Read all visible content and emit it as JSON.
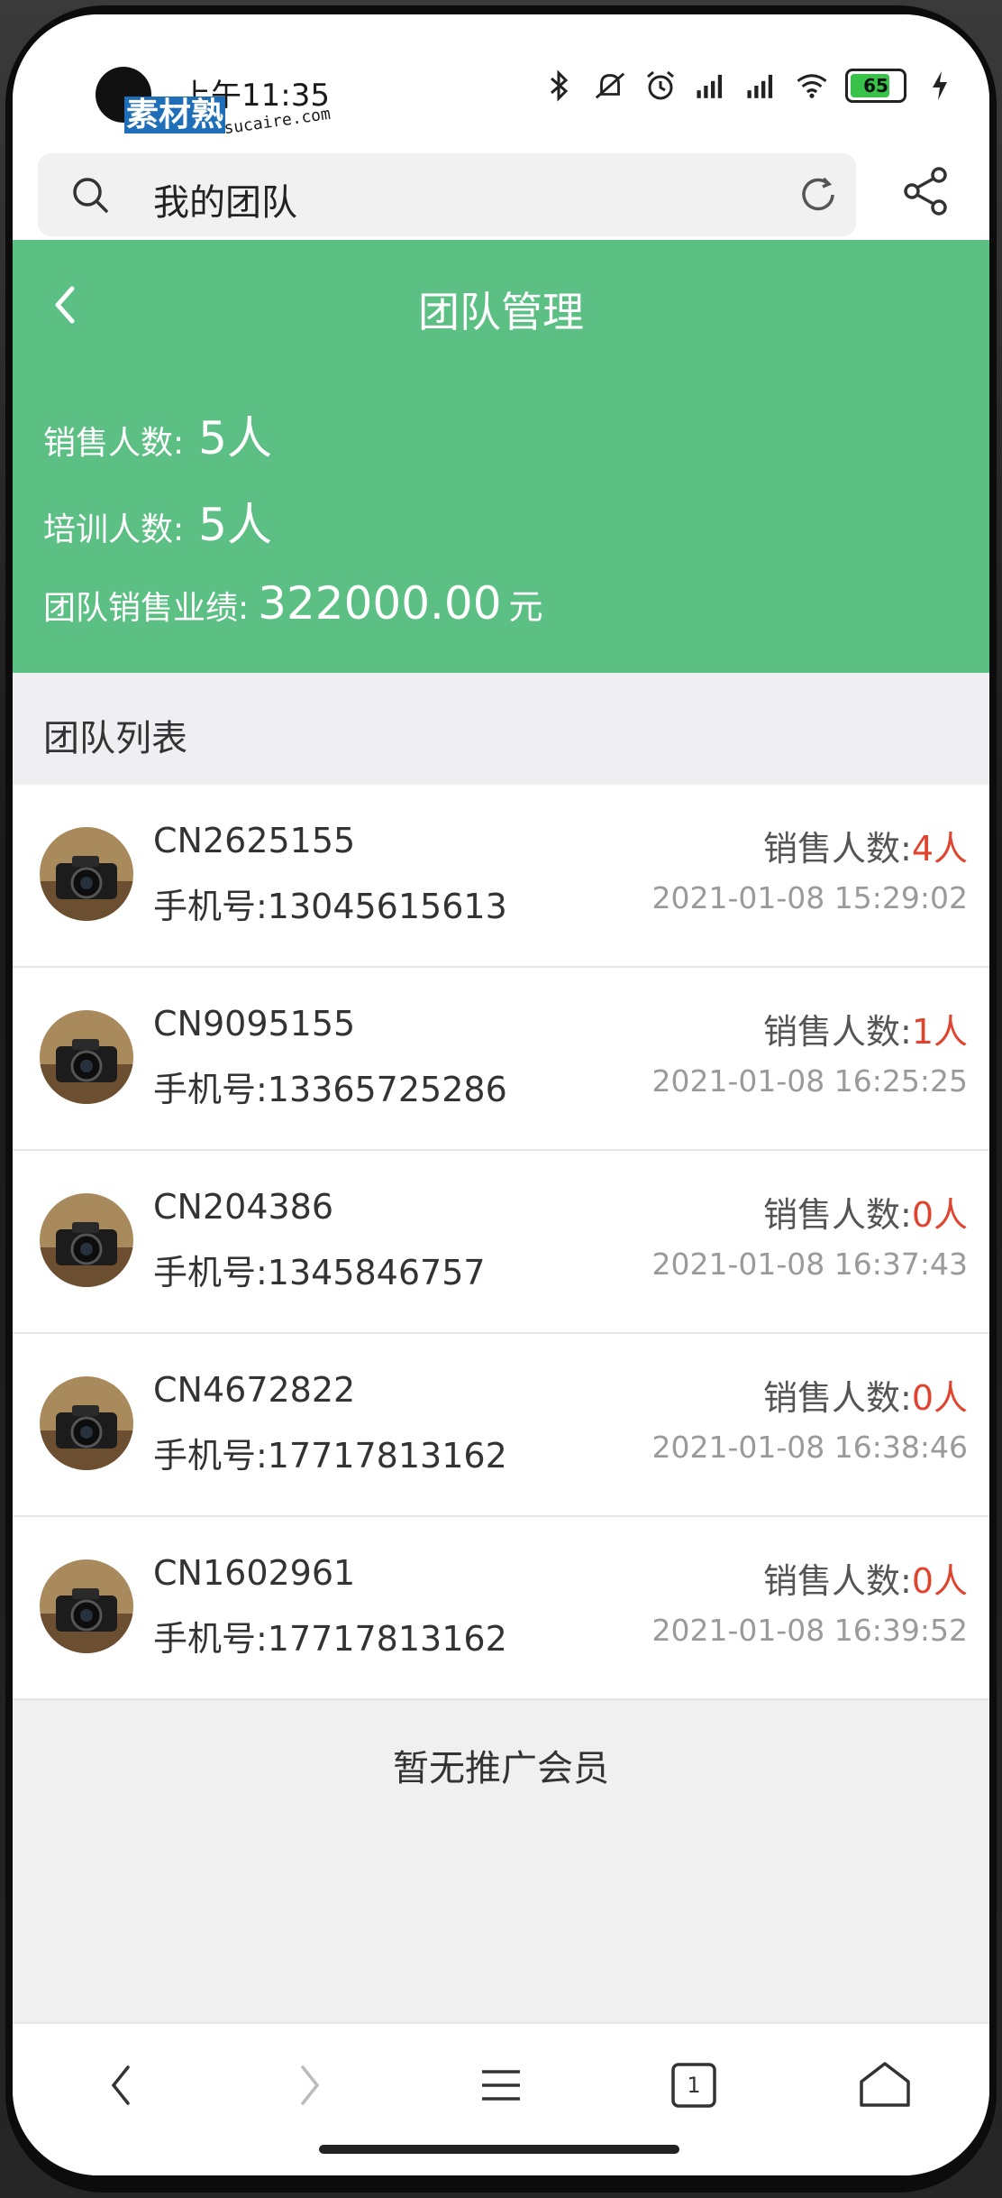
{
  "status_bar": {
    "time": "上午11:35",
    "watermark_main": "素材熟",
    "watermark_sub": "sucaire.com",
    "battery": "65"
  },
  "search": {
    "text": "我的团队"
  },
  "header": {
    "title": "团队管理",
    "sales_label": "销售人数:",
    "sales_value": "5人",
    "training_label": "培训人数:",
    "training_value": "5人",
    "performance_label": "团队销售业绩:",
    "performance_value": "322000.00",
    "performance_unit": "元"
  },
  "list": {
    "heading": "团队列表",
    "sales_label": "销售人数:",
    "items": [
      {
        "id": "CN2625155",
        "phone": "手机号:13045615613",
        "sales": "4人",
        "date": "2021-01-08 15:29:02"
      },
      {
        "id": "CN9095155",
        "phone": "手机号:13365725286",
        "sales": "1人",
        "date": "2021-01-08 16:25:25"
      },
      {
        "id": "CN204386",
        "phone": "手机号:1345846757",
        "sales": "0人",
        "date": "2021-01-08 16:37:43"
      },
      {
        "id": "CN4672822",
        "phone": "手机号:17717813162",
        "sales": "0人",
        "date": "2021-01-08 16:38:46"
      },
      {
        "id": "CN1602961",
        "phone": "手机号:17717813162",
        "sales": "0人",
        "date": "2021-01-08 16:39:52"
      }
    ]
  },
  "empty_text": "暂无推广会员",
  "bottom_nav": {
    "tab_count": "1"
  },
  "colors": {
    "header_green": "#5cbf84",
    "sales_red": "#e0442e"
  }
}
